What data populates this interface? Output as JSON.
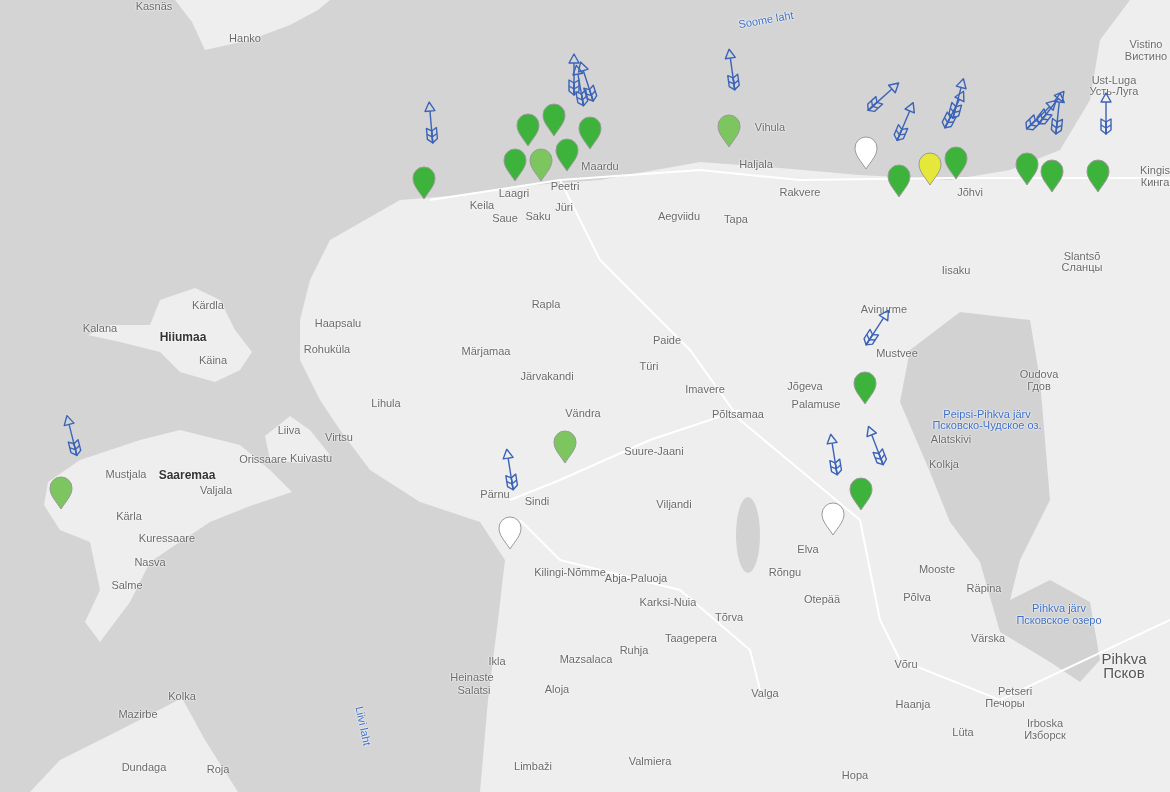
{
  "map": {
    "labels": [
      {
        "text": "Kasnäs",
        "kind": "town"
      },
      {
        "text": "Soome laht",
        "kind": "water"
      },
      {
        "text": "Hanko",
        "kind": "town"
      },
      {
        "text": "Vistino",
        "kind": "town"
      },
      {
        "text": "Вистино",
        "kind": "town"
      },
      {
        "text": "Ust-Luga",
        "kind": "town"
      },
      {
        "text": "Усть-Луга",
        "kind": "town"
      },
      {
        "text": "Vihula",
        "kind": "town"
      },
      {
        "text": "Maardu",
        "kind": "town"
      },
      {
        "text": "Haljala",
        "kind": "town"
      },
      {
        "text": "Kingis",
        "kind": "town"
      },
      {
        "text": "Laagri",
        "kind": "town"
      },
      {
        "text": "Peetri",
        "kind": "town"
      },
      {
        "text": "Rakvere",
        "kind": "town"
      },
      {
        "text": "Jõhvi",
        "kind": "town"
      },
      {
        "text": "Кинга",
        "kind": "town"
      },
      {
        "text": "Keila",
        "kind": "town"
      },
      {
        "text": "Jüri",
        "kind": "town"
      },
      {
        "text": "Saue",
        "kind": "town"
      },
      {
        "text": "Saku",
        "kind": "town"
      },
      {
        "text": "Aegviidu",
        "kind": "town"
      },
      {
        "text": "Tapa",
        "kind": "town"
      },
      {
        "text": "Slantsõ",
        "kind": "town"
      },
      {
        "text": "Iisaku",
        "kind": "town"
      },
      {
        "text": "Сланцы",
        "kind": "town"
      },
      {
        "text": "Kärdla",
        "kind": "town"
      },
      {
        "text": "Rapla",
        "kind": "town"
      },
      {
        "text": "Avinurme",
        "kind": "town"
      },
      {
        "text": "Kalana",
        "kind": "town"
      },
      {
        "text": "Haapsalu",
        "kind": "town"
      },
      {
        "text": "Hiiumaa",
        "kind": "region"
      },
      {
        "text": "Paide",
        "kind": "town"
      },
      {
        "text": "Käina",
        "kind": "town"
      },
      {
        "text": "Rohuküla",
        "kind": "town"
      },
      {
        "text": "Märjamaa",
        "kind": "town"
      },
      {
        "text": "Türi",
        "kind": "town"
      },
      {
        "text": "Mustvee",
        "kind": "town"
      },
      {
        "text": "Järvakandi",
        "kind": "town"
      },
      {
        "text": "Oudova",
        "kind": "town"
      },
      {
        "text": "Imavere",
        "kind": "town"
      },
      {
        "text": "Jõgeva",
        "kind": "town"
      },
      {
        "text": "Гдов",
        "kind": "town"
      },
      {
        "text": "Lihula",
        "kind": "town"
      },
      {
        "text": "Vändra",
        "kind": "town"
      },
      {
        "text": "Põltsamaa",
        "kind": "town"
      },
      {
        "text": "Palamuse",
        "kind": "town"
      },
      {
        "text": "Peipsi-Pihkva järv",
        "kind": "water"
      },
      {
        "text": "Liiva",
        "kind": "town"
      },
      {
        "text": "Псковско-Чудское оз.",
        "kind": "water"
      },
      {
        "text": "Virtsu",
        "kind": "town"
      },
      {
        "text": "Alatskivi",
        "kind": "town"
      },
      {
        "text": "Orissaare",
        "kind": "town"
      },
      {
        "text": "Kuivastu",
        "kind": "town"
      },
      {
        "text": "Suure-Jaani",
        "kind": "town"
      },
      {
        "text": "Mustjala",
        "kind": "town"
      },
      {
        "text": "Saaremaa",
        "kind": "region"
      },
      {
        "text": "Kolkja",
        "kind": "town"
      },
      {
        "text": "Valjala",
        "kind": "town"
      },
      {
        "text": "Pärnu",
        "kind": "town"
      },
      {
        "text": "Sindi",
        "kind": "town"
      },
      {
        "text": "Viljandi",
        "kind": "town"
      },
      {
        "text": "Kärla",
        "kind": "town"
      },
      {
        "text": "Kuressaare",
        "kind": "town"
      },
      {
        "text": "Elva",
        "kind": "town"
      },
      {
        "text": "Nasva",
        "kind": "town"
      },
      {
        "text": "Kilingi-Nõmme",
        "kind": "town"
      },
      {
        "text": "Salme",
        "kind": "town"
      },
      {
        "text": "Abja-Paluoja",
        "kind": "town"
      },
      {
        "text": "Rõngu",
        "kind": "town"
      },
      {
        "text": "Mooste",
        "kind": "town"
      },
      {
        "text": "Karksi-Nuia",
        "kind": "town"
      },
      {
        "text": "Otepää",
        "kind": "town"
      },
      {
        "text": "Põlva",
        "kind": "town"
      },
      {
        "text": "Räpina",
        "kind": "town"
      },
      {
        "text": "Tõrva",
        "kind": "town"
      },
      {
        "text": "Pihkva järv",
        "kind": "water"
      },
      {
        "text": "Псковское озеро",
        "kind": "water"
      },
      {
        "text": "Taagepera",
        "kind": "town"
      },
      {
        "text": "Värska",
        "kind": "town"
      },
      {
        "text": "Ikla",
        "kind": "town"
      },
      {
        "text": "Mazsalaca",
        "kind": "town"
      },
      {
        "text": "Ruhja",
        "kind": "town"
      },
      {
        "text": "Võru",
        "kind": "town"
      },
      {
        "text": "Pihkva",
        "kind": "city"
      },
      {
        "text": "Heinaste",
        "kind": "town"
      },
      {
        "text": "Псков",
        "kind": "city"
      },
      {
        "text": "Kolka",
        "kind": "town"
      },
      {
        "text": "Salatsi",
        "kind": "town"
      },
      {
        "text": "Aloja",
        "kind": "town"
      },
      {
        "text": "Valga",
        "kind": "town"
      },
      {
        "text": "Petseri",
        "kind": "town"
      },
      {
        "text": "Mazirbe",
        "kind": "town"
      },
      {
        "text": "Liivi laht",
        "kind": "water"
      },
      {
        "text": "Haanja",
        "kind": "town"
      },
      {
        "text": "Печоры",
        "kind": "town"
      },
      {
        "text": "Lüta",
        "kind": "town"
      },
      {
        "text": "Irboska",
        "kind": "town"
      },
      {
        "text": "Изборск",
        "kind": "town"
      },
      {
        "text": "Dundaga",
        "kind": "town"
      },
      {
        "text": "Roja",
        "kind": "town"
      },
      {
        "text": "Limbaži",
        "kind": "town"
      },
      {
        "text": "Valmiera",
        "kind": "town"
      },
      {
        "text": "Hopa",
        "kind": "town"
      }
    ],
    "pins": [
      {
        "color": "#3db33b"
      },
      {
        "color": "#3db33b"
      },
      {
        "color": "#3db33b"
      },
      {
        "color": "#7cc55f"
      },
      {
        "color": "#3db33b"
      },
      {
        "color": "#3db33b"
      },
      {
        "color": "#3db33b"
      },
      {
        "color": "#7cc55f"
      },
      {
        "color": "#ffffff"
      },
      {
        "color": "#3db33b"
      },
      {
        "color": "#3db33b"
      },
      {
        "color": "#e5e83a"
      },
      {
        "color": "#3db33b"
      },
      {
        "color": "#3db33b"
      },
      {
        "color": "#3db33b"
      },
      {
        "color": "#3db33b"
      },
      {
        "color": "#7cc55f"
      },
      {
        "color": "#ffffff"
      },
      {
        "color": "#3db33b"
      },
      {
        "color": "#ffffff"
      },
      {
        "color": "#7cc55f"
      }
    ]
  }
}
